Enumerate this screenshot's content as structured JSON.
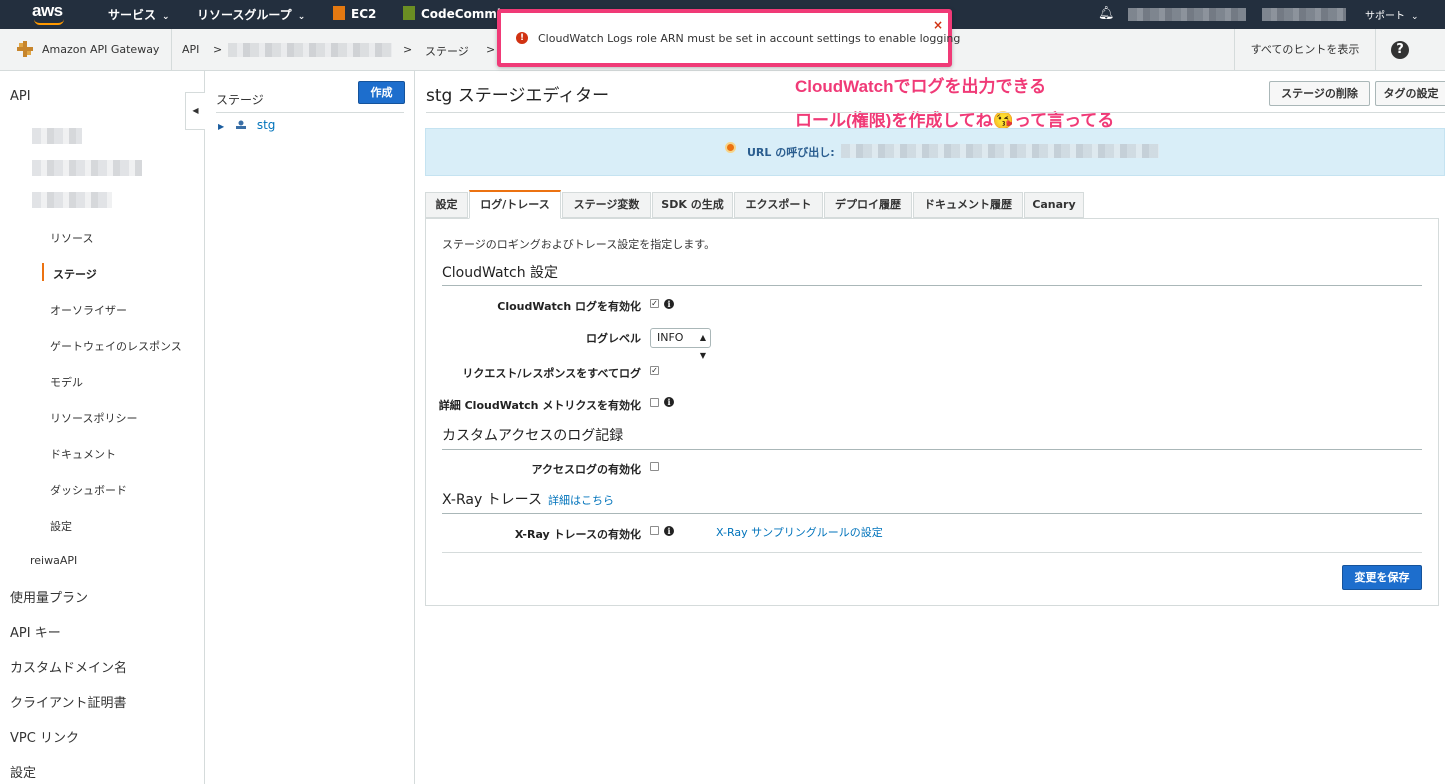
{
  "topnav": {
    "logo": "aws",
    "services": "サービス",
    "resource_groups": "リソースグループ",
    "shortcut_ec2": "EC2",
    "shortcut_codecommit": "CodeCommit",
    "support": "サポート"
  },
  "breadcrumb": {
    "service": "Amazon API Gateway",
    "api": "API",
    "sep": ">",
    "stage": "ステージ",
    "hints": "すべてのヒントを表示",
    "help": "?"
  },
  "alert": {
    "message": "CloudWatch Logs role ARN must be set in account settings to enable logging",
    "close": "×",
    "icon": "!"
  },
  "annotation": {
    "line1": "CloudWatchでログを出力できる",
    "line2": "ロール(権限)を作成してね😘って言ってる"
  },
  "sidebar": {
    "api": "API",
    "items": [
      "リソース",
      "ステージ",
      "オーソライザー",
      "ゲートウェイのレスポンス",
      "モデル",
      "リソースポリシー",
      "ドキュメント",
      "ダッシュボード",
      "設定"
    ],
    "api2": "reiwaAPI",
    "top_items": [
      "使用量プラン",
      "API キー",
      "カスタムドメイン名",
      "クライアント証明書",
      "VPC リンク",
      "設定"
    ]
  },
  "stages": {
    "title": "ステージ",
    "create": "作成",
    "node": "stg"
  },
  "main": {
    "title": "stg ステージエディター",
    "delete_button": "ステージの削除",
    "tags_button": "タグの設定",
    "url_label": "URL の呼び出し:",
    "tabs": [
      "設定",
      "ログ/トレース",
      "ステージ変数",
      "SDK の生成",
      "エクスポート",
      "デプロイ履歴",
      "ドキュメント履歴",
      "Canary"
    ],
    "active_tab": "ログ/トレース",
    "description": "ステージのロギングおよびトレース設定を指定します。",
    "cloudwatch": {
      "heading": "CloudWatch 設定",
      "enable_logs": "CloudWatch ログを有効化",
      "enable_logs_checked": true,
      "log_level_label": "ログレベル",
      "log_level": "INFO",
      "log_full": "リクエスト/レスポンスをすべてログ",
      "log_full_checked": true,
      "metrics": "詳細 CloudWatch メトリクスを有効化",
      "metrics_checked": false
    },
    "access_log": {
      "heading": "カスタムアクセスのログ記録",
      "enable": "アクセスログの有効化",
      "checked": false
    },
    "xray": {
      "heading": "X-Ray トレース",
      "details_link": "詳細はこちら",
      "enable": "X-Ray トレースの有効化",
      "checked": false,
      "sampling_link": "X-Ray サンプリングルールの設定"
    },
    "save": "変更を保存"
  }
}
